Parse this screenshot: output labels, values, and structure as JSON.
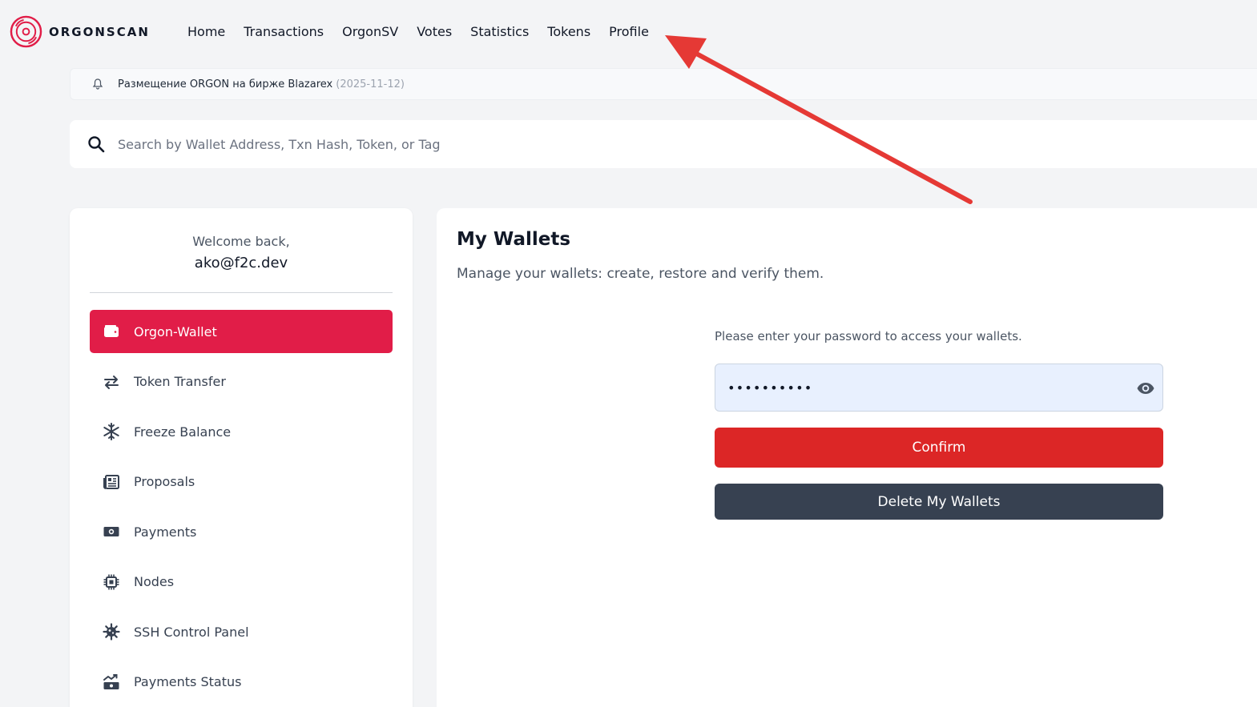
{
  "brand": {
    "name": "ORGONSCAN",
    "accent": "#e11d48"
  },
  "nav": [
    "Home",
    "Transactions",
    "OrgonSV",
    "Votes",
    "Statistics",
    "Tokens",
    "Profile"
  ],
  "announcement": {
    "icon": "bell-icon",
    "text": "Размещение ORGON на бирже Blazarex",
    "date": "(2025-11-12)"
  },
  "search": {
    "icon": "search-icon",
    "placeholder": "Search by Wallet Address, Txn Hash, Token, or Tag"
  },
  "sidebar": {
    "welcome": "Welcome back,",
    "user": "ako@f2c.dev",
    "items": [
      {
        "label": "Orgon-Wallet",
        "icon": "wallet-icon",
        "active": true
      },
      {
        "label": "Token Transfer",
        "icon": "transfer-arrows-icon"
      },
      {
        "label": "Freeze Balance",
        "icon": "snowflake-icon"
      },
      {
        "label": "Proposals",
        "icon": "newspaper-icon"
      },
      {
        "label": "Payments",
        "icon": "money-bill-icon"
      },
      {
        "label": "Nodes",
        "icon": "microchip-icon"
      },
      {
        "label": "SSH Control Panel",
        "icon": "virus-gear-icon"
      },
      {
        "label": "Payments Status",
        "icon": "money-chart-icon"
      }
    ]
  },
  "main": {
    "title": "My Wallets",
    "subtitle": "Manage your wallets: create, restore and verify them.",
    "password_prompt": "Please enter your password to access your wallets.",
    "password_value": "••••••••••",
    "confirm_label": "Confirm",
    "delete_label": "Delete My Wallets"
  },
  "colors": {
    "confirm": "#dc2626",
    "delete": "#374151",
    "active_menu": "#e11d48",
    "arrow": "#e53935"
  }
}
